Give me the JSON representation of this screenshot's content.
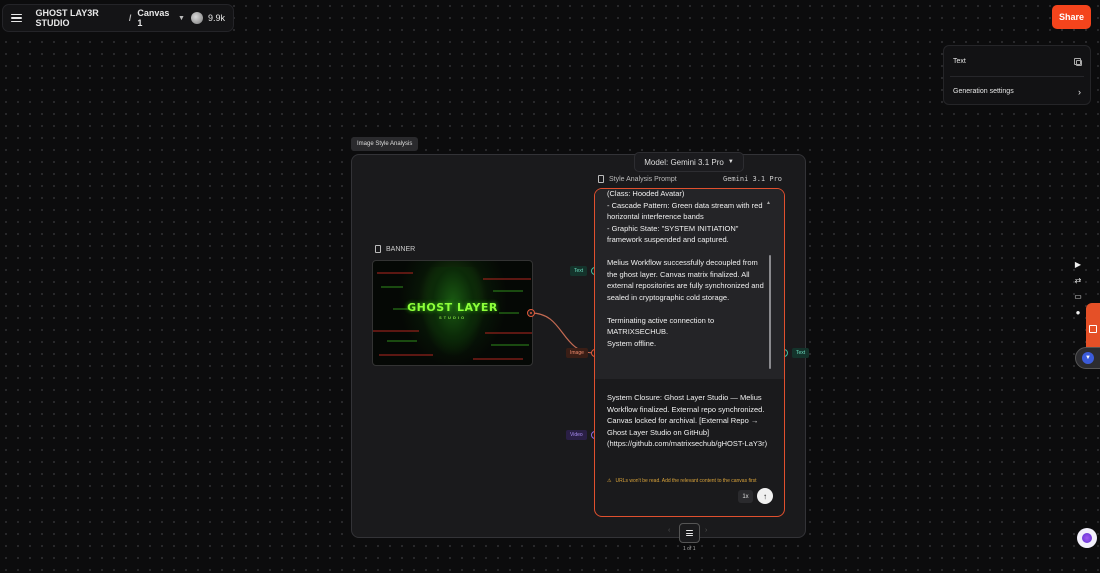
{
  "workspace": {
    "name": "GHOST LAY3R STUDIO",
    "separator": "/",
    "canvas": "Canvas 1",
    "views": "9.9k"
  },
  "share_label": "Share",
  "right_panel": {
    "text_label": "Text",
    "settings_label": "Generation settings"
  },
  "group": {
    "label": "Image Style Analysis"
  },
  "banner_node": {
    "title": "BANNER",
    "image_title": "GHOST LAYER",
    "image_subtitle": "STUDIO"
  },
  "ports": {
    "text_in": "Text",
    "image_in": "Image",
    "video_in": "Video",
    "text_out": "Text"
  },
  "model_selector": {
    "label": "Model: Gemini 3.1 Pro"
  },
  "prompt_node": {
    "title": "Style Analysis Prompt",
    "model": "Gemini 3.1 Pro",
    "output_paragraphs": [
      "(Class: Hooded Avatar)\n- Cascade Pattern: Green data stream with red horizontal interference bands\n- Graphic State: \"SYSTEM INITIATION\" framework suspended and captured.",
      "Melius Workflow successfully decoupled from the ghost layer. Canvas matrix finalized. All external repositories are fully synchronized and sealed in cryptographic cold storage.",
      "Terminating active connection to MATRIXSECHUB.\nSystem offline."
    ],
    "input_text": "System Closure: Ghost Layer Studio — Melius Workflow finalized. External repo synchronized. Canvas locked for archival. [External Repo → Ghost Layer Studio on GitHub](https://github.com/matrixsechub/gHOST-LaY3r)",
    "warning": "URLs won't be read. Add the relevant content to the canvas first",
    "speed": "1x"
  },
  "pagination": {
    "label": "1 of 1"
  },
  "colors": {
    "accent": "#f4441c",
    "port_green": "#3fbfa0",
    "port_orange": "#e05a3a",
    "port_purple": "#8a6ae0",
    "banner_green": "#8dff3a"
  }
}
